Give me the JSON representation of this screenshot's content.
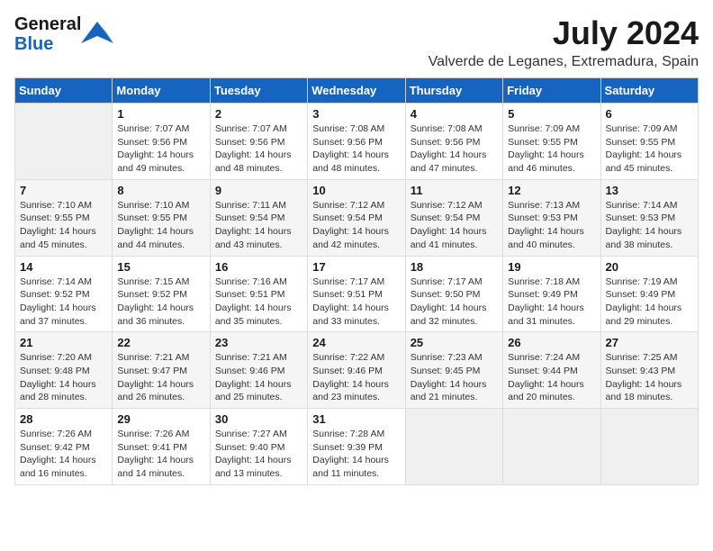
{
  "header": {
    "logo_general": "General",
    "logo_blue": "Blue",
    "month_year": "July 2024",
    "location": "Valverde de Leganes, Extremadura, Spain"
  },
  "weekdays": [
    "Sunday",
    "Monday",
    "Tuesday",
    "Wednesday",
    "Thursday",
    "Friday",
    "Saturday"
  ],
  "weeks": [
    [
      {
        "day": "",
        "info": ""
      },
      {
        "day": "1",
        "info": "Sunrise: 7:07 AM\nSunset: 9:56 PM\nDaylight: 14 hours\nand 49 minutes."
      },
      {
        "day": "2",
        "info": "Sunrise: 7:07 AM\nSunset: 9:56 PM\nDaylight: 14 hours\nand 48 minutes."
      },
      {
        "day": "3",
        "info": "Sunrise: 7:08 AM\nSunset: 9:56 PM\nDaylight: 14 hours\nand 48 minutes."
      },
      {
        "day": "4",
        "info": "Sunrise: 7:08 AM\nSunset: 9:56 PM\nDaylight: 14 hours\nand 47 minutes."
      },
      {
        "day": "5",
        "info": "Sunrise: 7:09 AM\nSunset: 9:55 PM\nDaylight: 14 hours\nand 46 minutes."
      },
      {
        "day": "6",
        "info": "Sunrise: 7:09 AM\nSunset: 9:55 PM\nDaylight: 14 hours\nand 45 minutes."
      }
    ],
    [
      {
        "day": "7",
        "info": "Sunrise: 7:10 AM\nSunset: 9:55 PM\nDaylight: 14 hours\nand 45 minutes."
      },
      {
        "day": "8",
        "info": "Sunrise: 7:10 AM\nSunset: 9:55 PM\nDaylight: 14 hours\nand 44 minutes."
      },
      {
        "day": "9",
        "info": "Sunrise: 7:11 AM\nSunset: 9:54 PM\nDaylight: 14 hours\nand 43 minutes."
      },
      {
        "day": "10",
        "info": "Sunrise: 7:12 AM\nSunset: 9:54 PM\nDaylight: 14 hours\nand 42 minutes."
      },
      {
        "day": "11",
        "info": "Sunrise: 7:12 AM\nSunset: 9:54 PM\nDaylight: 14 hours\nand 41 minutes."
      },
      {
        "day": "12",
        "info": "Sunrise: 7:13 AM\nSunset: 9:53 PM\nDaylight: 14 hours\nand 40 minutes."
      },
      {
        "day": "13",
        "info": "Sunrise: 7:14 AM\nSunset: 9:53 PM\nDaylight: 14 hours\nand 38 minutes."
      }
    ],
    [
      {
        "day": "14",
        "info": "Sunrise: 7:14 AM\nSunset: 9:52 PM\nDaylight: 14 hours\nand 37 minutes."
      },
      {
        "day": "15",
        "info": "Sunrise: 7:15 AM\nSunset: 9:52 PM\nDaylight: 14 hours\nand 36 minutes."
      },
      {
        "day": "16",
        "info": "Sunrise: 7:16 AM\nSunset: 9:51 PM\nDaylight: 14 hours\nand 35 minutes."
      },
      {
        "day": "17",
        "info": "Sunrise: 7:17 AM\nSunset: 9:51 PM\nDaylight: 14 hours\nand 33 minutes."
      },
      {
        "day": "18",
        "info": "Sunrise: 7:17 AM\nSunset: 9:50 PM\nDaylight: 14 hours\nand 32 minutes."
      },
      {
        "day": "19",
        "info": "Sunrise: 7:18 AM\nSunset: 9:49 PM\nDaylight: 14 hours\nand 31 minutes."
      },
      {
        "day": "20",
        "info": "Sunrise: 7:19 AM\nSunset: 9:49 PM\nDaylight: 14 hours\nand 29 minutes."
      }
    ],
    [
      {
        "day": "21",
        "info": "Sunrise: 7:20 AM\nSunset: 9:48 PM\nDaylight: 14 hours\nand 28 minutes."
      },
      {
        "day": "22",
        "info": "Sunrise: 7:21 AM\nSunset: 9:47 PM\nDaylight: 14 hours\nand 26 minutes."
      },
      {
        "day": "23",
        "info": "Sunrise: 7:21 AM\nSunset: 9:46 PM\nDaylight: 14 hours\nand 25 minutes."
      },
      {
        "day": "24",
        "info": "Sunrise: 7:22 AM\nSunset: 9:46 PM\nDaylight: 14 hours\nand 23 minutes."
      },
      {
        "day": "25",
        "info": "Sunrise: 7:23 AM\nSunset: 9:45 PM\nDaylight: 14 hours\nand 21 minutes."
      },
      {
        "day": "26",
        "info": "Sunrise: 7:24 AM\nSunset: 9:44 PM\nDaylight: 14 hours\nand 20 minutes."
      },
      {
        "day": "27",
        "info": "Sunrise: 7:25 AM\nSunset: 9:43 PM\nDaylight: 14 hours\nand 18 minutes."
      }
    ],
    [
      {
        "day": "28",
        "info": "Sunrise: 7:26 AM\nSunset: 9:42 PM\nDaylight: 14 hours\nand 16 minutes."
      },
      {
        "day": "29",
        "info": "Sunrise: 7:26 AM\nSunset: 9:41 PM\nDaylight: 14 hours\nand 14 minutes."
      },
      {
        "day": "30",
        "info": "Sunrise: 7:27 AM\nSunset: 9:40 PM\nDaylight: 14 hours\nand 13 minutes."
      },
      {
        "day": "31",
        "info": "Sunrise: 7:28 AM\nSunset: 9:39 PM\nDaylight: 14 hours\nand 11 minutes."
      },
      {
        "day": "",
        "info": ""
      },
      {
        "day": "",
        "info": ""
      },
      {
        "day": "",
        "info": ""
      }
    ]
  ]
}
